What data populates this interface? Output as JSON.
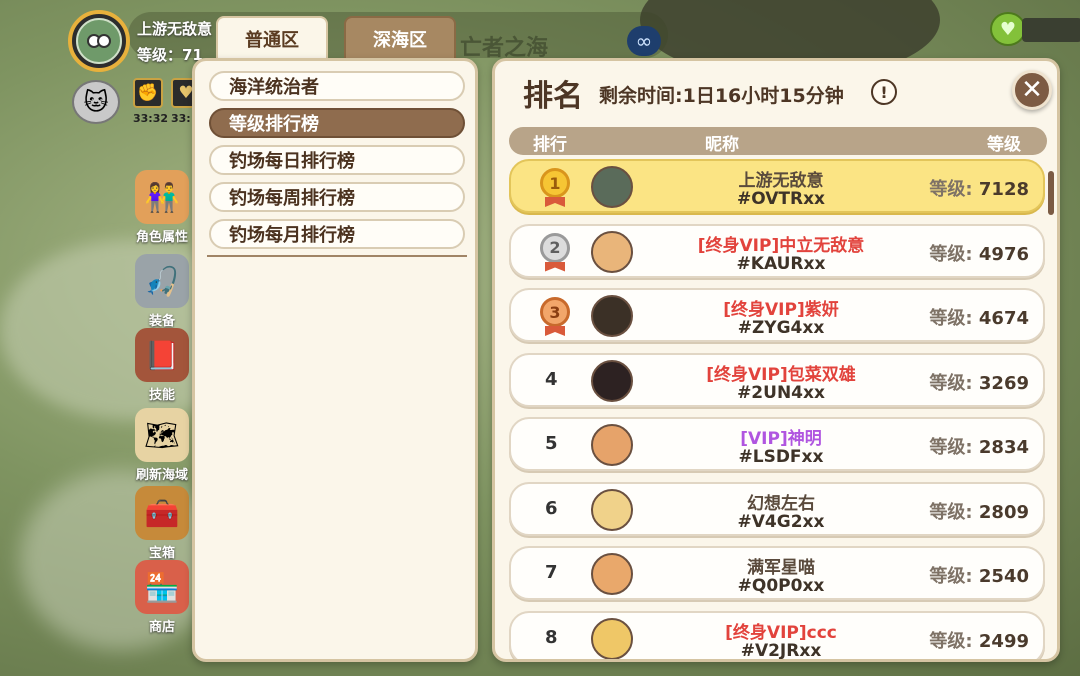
{
  "hud": {
    "player_name": "上游无敌意",
    "level_text": "等级：71",
    "zone_title": "亡者之海",
    "infinity_icon": "∞",
    "buff_times": [
      "33:32",
      "33:"
    ]
  },
  "tabs": {
    "normal": "普通区",
    "deep": "深海区"
  },
  "side_menu": [
    {
      "label": "角色属性",
      "icon": "characters-icon"
    },
    {
      "label": "装备",
      "icon": "fishing-rod-icon"
    },
    {
      "label": "技能",
      "icon": "skill-book-icon"
    },
    {
      "label": "刷新海域",
      "icon": "treasure-map-icon"
    },
    {
      "label": "宝箱",
      "icon": "treasure-chest-icon"
    },
    {
      "label": "商店",
      "icon": "shop-icon"
    }
  ],
  "leaderboards": [
    {
      "label": "海洋统治者",
      "active": false
    },
    {
      "label": "等级排行榜",
      "active": true
    },
    {
      "label": "钓场每日排行榜",
      "active": false
    },
    {
      "label": "钓场每周排行榜",
      "active": false
    },
    {
      "label": "钓场每月排行榜",
      "active": false
    }
  ],
  "ranking": {
    "title": "排名",
    "timer": "剩余时间:1日16小时15分钟",
    "info_icon": "!",
    "close_icon": "✕",
    "columns": {
      "rank": "排行",
      "name": "昵称",
      "level": "等级"
    },
    "level_prefix": "等级:",
    "rows": [
      {
        "rank": "1",
        "name": "上游无敌意",
        "id": "#OVTRxx",
        "level": "7128",
        "type": "normal"
      },
      {
        "rank": "2",
        "name": "[终身VIP]中立无敌意",
        "id": "#KAURxx",
        "level": "4976",
        "type": "vip-life"
      },
      {
        "rank": "3",
        "name": "[终身VIP]紫妍",
        "id": "#ZYG4xx",
        "level": "4674",
        "type": "vip-life"
      },
      {
        "rank": "4",
        "name": "[终身VIP]包菜双雄",
        "id": "#2UN4xx",
        "level": "3269",
        "type": "vip-life"
      },
      {
        "rank": "5",
        "name": "[VIP]神明",
        "id": "#LSDFxx",
        "level": "2834",
        "type": "vip"
      },
      {
        "rank": "6",
        "name": "幻想左右",
        "id": "#V4G2xx",
        "level": "2809",
        "type": "normal"
      },
      {
        "rank": "7",
        "name": "满军星喵",
        "id": "#Q0P0xx",
        "level": "2540",
        "type": "normal"
      },
      {
        "rank": "8",
        "name": "[终身VIP]ccc",
        "id": "#V2JRxx",
        "level": "2499",
        "type": "vip-life"
      }
    ]
  },
  "colors": {
    "gold_row": "#fbe484",
    "vip_life": "#e2433c",
    "vip": "#b055e0",
    "panel": "#fbf6ea",
    "accent_brown": "#8f6c4e"
  }
}
